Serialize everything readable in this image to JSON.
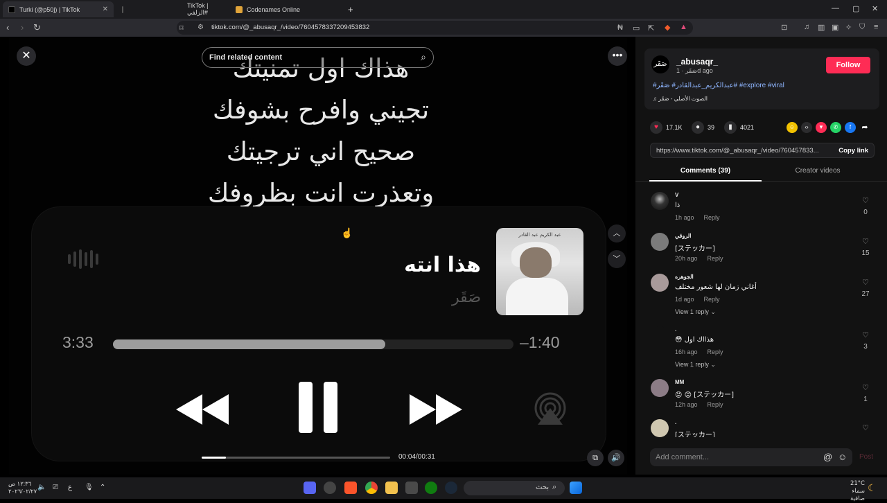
{
  "browser": {
    "tabs": [
      {
        "label": "Turki (@p50j) | TikTok",
        "active": true
      },
      {
        "label": "",
        "active": false
      },
      {
        "label": "TikTok | الزلفي#",
        "active": false
      },
      {
        "label": "Codenames Online",
        "active": false
      }
    ],
    "new_tab": "+",
    "url": "tiktok.com/@_abusaqr_/video/7604578337209453832"
  },
  "video": {
    "find_related_label": "Find related content",
    "lyrics": [
      "هذاك اول تمنيتك",
      "تجيني وافرح بشوفك",
      "صحيح اني ترجيتك",
      "وتعذرت انت بظروفك"
    ],
    "song_title": "هذا انته",
    "song_artist": "صَقَر",
    "album_caption": "عبد الكريم عبد القادر",
    "elapsed": "3:33",
    "remaining": "–1:40",
    "scrubber_progress": 0.68,
    "mini_progress": 0.13,
    "time_readout": "00:04/00:31"
  },
  "author": {
    "avatar_text": "صَقَر",
    "username": "_abusaqr_",
    "meta": "صَقَر · 1d ago",
    "follow_label": "Follow",
    "hashtags": "#عبدالكريم_عبدالقادر# صَقَر# #explore #viral",
    "music": "♫ الصوت الأصلي - صَقَر"
  },
  "stats": {
    "likes": "17.1K",
    "comments": "39",
    "saves": "4021"
  },
  "copy_link": {
    "url": "https://www.tiktok.com/@_abusaqr_/video/760457833...",
    "button": "Copy link"
  },
  "panel_tabs": {
    "comments": "Comments (39)",
    "creator": "Creator videos"
  },
  "comments": [
    {
      "user": "V",
      "text": "ذا",
      "time": "1h ago",
      "reply": "Reply",
      "likes": "0",
      "replies": ""
    },
    {
      "user": "الروقي",
      "text": "[ステッカー]",
      "time": "20h ago",
      "reply": "Reply",
      "likes": "15",
      "replies": ""
    },
    {
      "user": "الجوهره",
      "text": "أغاني زمان لها شعور مختلف",
      "time": "1d ago",
      "reply": "Reply",
      "likes": "27",
      "replies": "View 1 reply ⌄"
    },
    {
      "user": ".",
      "text": "😳 هذااك اول",
      "time": "16h ago",
      "reply": "Reply",
      "likes": "3",
      "replies": "View 1 reply ⌄"
    },
    {
      "user": "MM",
      "text": "😡 😡 [ステッカー]",
      "time": "12h ago",
      "reply": "Reply",
      "likes": "1",
      "replies": ""
    },
    {
      "user": ".",
      "text": "[ステッカー]",
      "time": "",
      "reply": "",
      "likes": "",
      "replies": ""
    }
  ],
  "add_comment": {
    "placeholder": "Add comment...",
    "post": "Post"
  },
  "taskbar": {
    "clock_time": "١٢:٣٦ ص",
    "clock_date": "٢٠٢٦/٠٢/٢٧",
    "lang": "ع",
    "search_placeholder": "بحث",
    "temp": "21°C",
    "weather_text": "سماء صافية"
  },
  "colors": {
    "follow": "#fe2c55",
    "hashtag": "#8fb6ff"
  }
}
